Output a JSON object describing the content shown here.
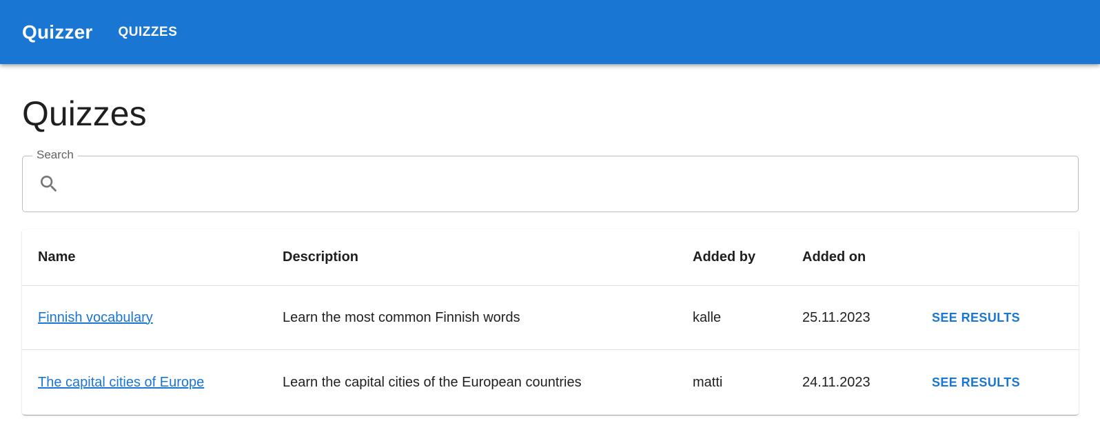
{
  "appbar": {
    "brand": "Quizzer",
    "nav": [
      {
        "label": "QUIZZES"
      }
    ]
  },
  "page": {
    "title": "Quizzes"
  },
  "search": {
    "label": "Search",
    "value": "",
    "icon": "search-icon"
  },
  "table": {
    "headers": {
      "name": "Name",
      "description": "Description",
      "added_by": "Added by",
      "added_on": "Added on"
    },
    "rows": [
      {
        "name": "Finnish vocabulary",
        "description": "Learn the most common Finnish words",
        "added_by": "kalle",
        "added_on": "25.11.2023",
        "action": "SEE RESULTS"
      },
      {
        "name": "The capital cities of Europe",
        "description": "Learn the capital cities of the European countries",
        "added_by": "matti",
        "added_on": "24.11.2023",
        "action": "SEE RESULTS"
      }
    ]
  },
  "colors": {
    "primary": "#1976d2",
    "text": "#1f1f1f",
    "border": "#bdbdbd"
  }
}
